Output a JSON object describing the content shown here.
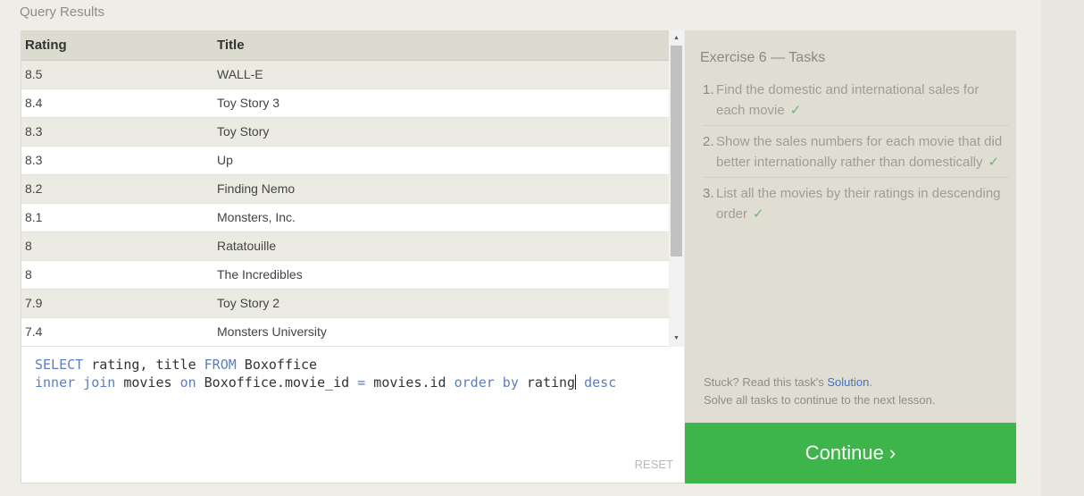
{
  "section_title": "Query Results",
  "results": {
    "columns": [
      "Rating",
      "Title"
    ],
    "rows": [
      [
        "8.5",
        "WALL-E"
      ],
      [
        "8.4",
        "Toy Story 3"
      ],
      [
        "8.3",
        "Toy Story"
      ],
      [
        "8.3",
        "Up"
      ],
      [
        "8.2",
        "Finding Nemo"
      ],
      [
        "8.1",
        "Monsters, Inc."
      ],
      [
        "8",
        "Ratatouille"
      ],
      [
        "8",
        "The Incredibles"
      ],
      [
        "7.9",
        "Toy Story 2"
      ],
      [
        "7.4",
        "Monsters University"
      ]
    ]
  },
  "editor": {
    "line1": {
      "kw1": "SELECT",
      "t1": " rating, title ",
      "kw2": "FROM",
      "t2": " Boxoffice"
    },
    "line2": {
      "kw1": "inner join",
      "t1": " movies ",
      "kw2": "on",
      "t2": " Boxoffice.movie_id ",
      "kw3": "=",
      "t3": " movies.id ",
      "kw4": "order by",
      "t4": " rating",
      "kw5": "desc"
    },
    "reset_label": "RESET"
  },
  "tasks": {
    "title": "Exercise 6 — Tasks",
    "items": [
      {
        "num": "1.",
        "text": "Find the domestic and international sales for each movie",
        "check": "✓"
      },
      {
        "num": "2.",
        "text": "Show the sales numbers for each movie that did better internationally rather than domestically",
        "check": "✓"
      },
      {
        "num": "3.",
        "text": "List all the movies by their ratings in descending order",
        "check": "✓"
      }
    ],
    "stuck_prefix": "Stuck? Read this task's ",
    "solution_label": "Solution",
    "stuck_suffix": ".",
    "solve_all": "Solve all tasks to continue to the next lesson."
  },
  "continue_label": "Continue ›",
  "colors": {
    "accent": "#3db54a",
    "link": "#3e72c8",
    "keyword": "#5b7ec0"
  }
}
